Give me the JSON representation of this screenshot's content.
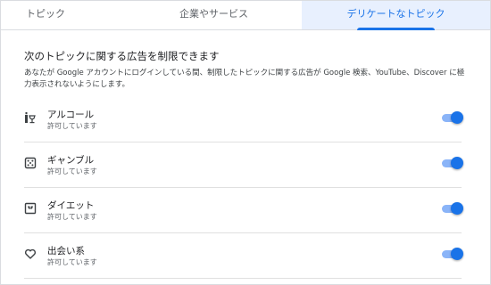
{
  "tabs": [
    {
      "label": "トピック",
      "selected": false
    },
    {
      "label": "企業やサービス",
      "selected": false
    },
    {
      "label": "デリケートなトピック",
      "selected": true
    }
  ],
  "heading": "次のトピックに関する広告を制限できます",
  "description": "あなたが Google アカウントにログインしている間、制限したトピックに関する広告が Google 検索、YouTube、Discover に極力表示されないようにします。",
  "topics": [
    {
      "name": "アルコール",
      "status": "許可しています",
      "icon": "alcohol-icon",
      "enabled": true
    },
    {
      "name": "ギャンブル",
      "status": "許可しています",
      "icon": "dice-icon",
      "enabled": true
    },
    {
      "name": "ダイエット",
      "status": "許可しています",
      "icon": "scale-icon",
      "enabled": true
    },
    {
      "name": "出会い系",
      "status": "許可しています",
      "icon": "heart-icon",
      "enabled": true
    }
  ],
  "colors": {
    "accent": "#1a73e8",
    "selected_tab_bg": "#e8f0fe",
    "toggle_track": "#8ab4f8"
  }
}
